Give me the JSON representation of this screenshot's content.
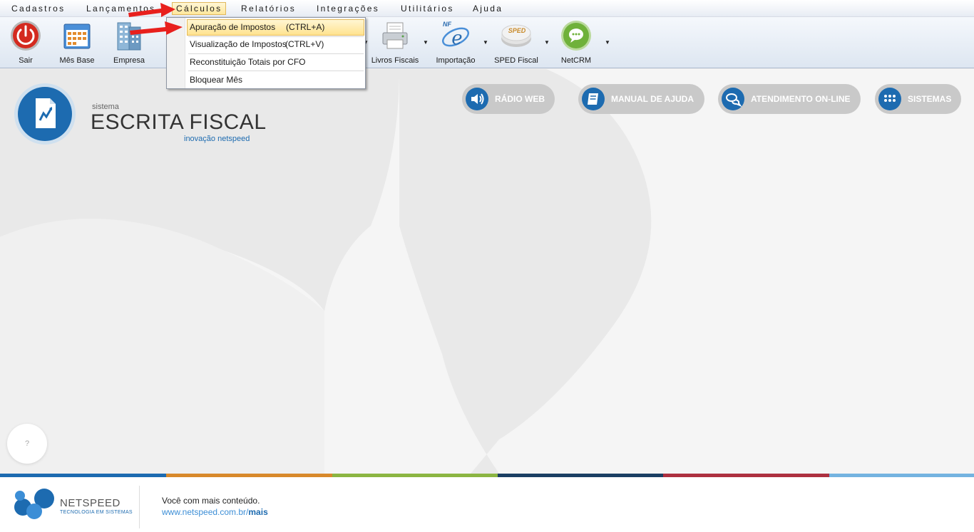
{
  "menubar": {
    "items": [
      "Cadastros",
      "Lançamentos",
      "Cálculos",
      "Relatórios",
      "Integrações",
      "Utilitários",
      "Ajuda"
    ],
    "active": "Cálculos"
  },
  "toolbar": {
    "sair": "Sair",
    "mes_base": "Mês Base",
    "empresa": "Empresa",
    "livros_fiscais": "Livros Fiscais",
    "importacao": "Importação",
    "sped_fiscal": "SPED Fiscal",
    "netcrm": "NetCRM",
    "nfe_badge": "NF",
    "sped_badge": "SPED"
  },
  "dropdown": {
    "items": [
      {
        "label": "Apuração de Impostos",
        "shortcut": "(CTRL+A)"
      },
      {
        "label": "Visualização de Impostos",
        "shortcut": "(CTRL+V)"
      },
      {
        "label": "Reconstituição Totais por CFO",
        "shortcut": ""
      },
      {
        "label": "Bloquear Mês",
        "shortcut": ""
      }
    ]
  },
  "brand": {
    "small": "sistema",
    "title": "ESCRITA FISCAL",
    "subtitle": "inovação netspeed"
  },
  "pills": {
    "radio": "RÁDIO WEB",
    "manual": "MANUAL DE AJUDA",
    "atendimento": "ATENDIMENTO ON-LINE",
    "sistemas": "SISTEMAS"
  },
  "help": "?",
  "footer": {
    "brand": "NETSPEED",
    "tagline": "TECNOLOGIA EM SISTEMAS",
    "text1": "Você com mais conteúdo.",
    "url_prefix": "www.netspeed.com.br/",
    "url_bold": "mais"
  },
  "colors": {
    "accent": "#1d6bb0",
    "stripe": [
      "#1d6bb0",
      "#d8892b",
      "#8bb542",
      "#1c3f63",
      "#ad3040",
      "#74b3e0"
    ],
    "annotation_arrow": "#e8201d"
  }
}
